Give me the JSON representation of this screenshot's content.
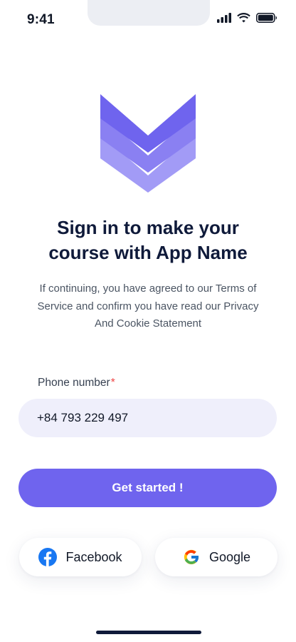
{
  "status_bar": {
    "time": "9:41"
  },
  "logo": {
    "icon": "layered-chevron-logo-icon",
    "colors": [
      "#6f64ee",
      "#8a80f2",
      "#a29bf6"
    ]
  },
  "headline": "Sign in to make your\ncourse with App Name",
  "subtext": "If continuing, you have agreed to our Terms of\nService and confirm you have read our Privacy\nAnd Cookie Statement",
  "phone_field": {
    "label": "Phone number",
    "required_mark": "*",
    "value": "+84 793 229 497"
  },
  "primary_button": {
    "label": "Get started !"
  },
  "social": {
    "facebook_label": "Facebook",
    "google_label": "Google"
  },
  "colors": {
    "accent": "#6f64ee",
    "input_bg": "#efeffb",
    "headline": "#0f1a3a",
    "required": "#ef4444"
  }
}
